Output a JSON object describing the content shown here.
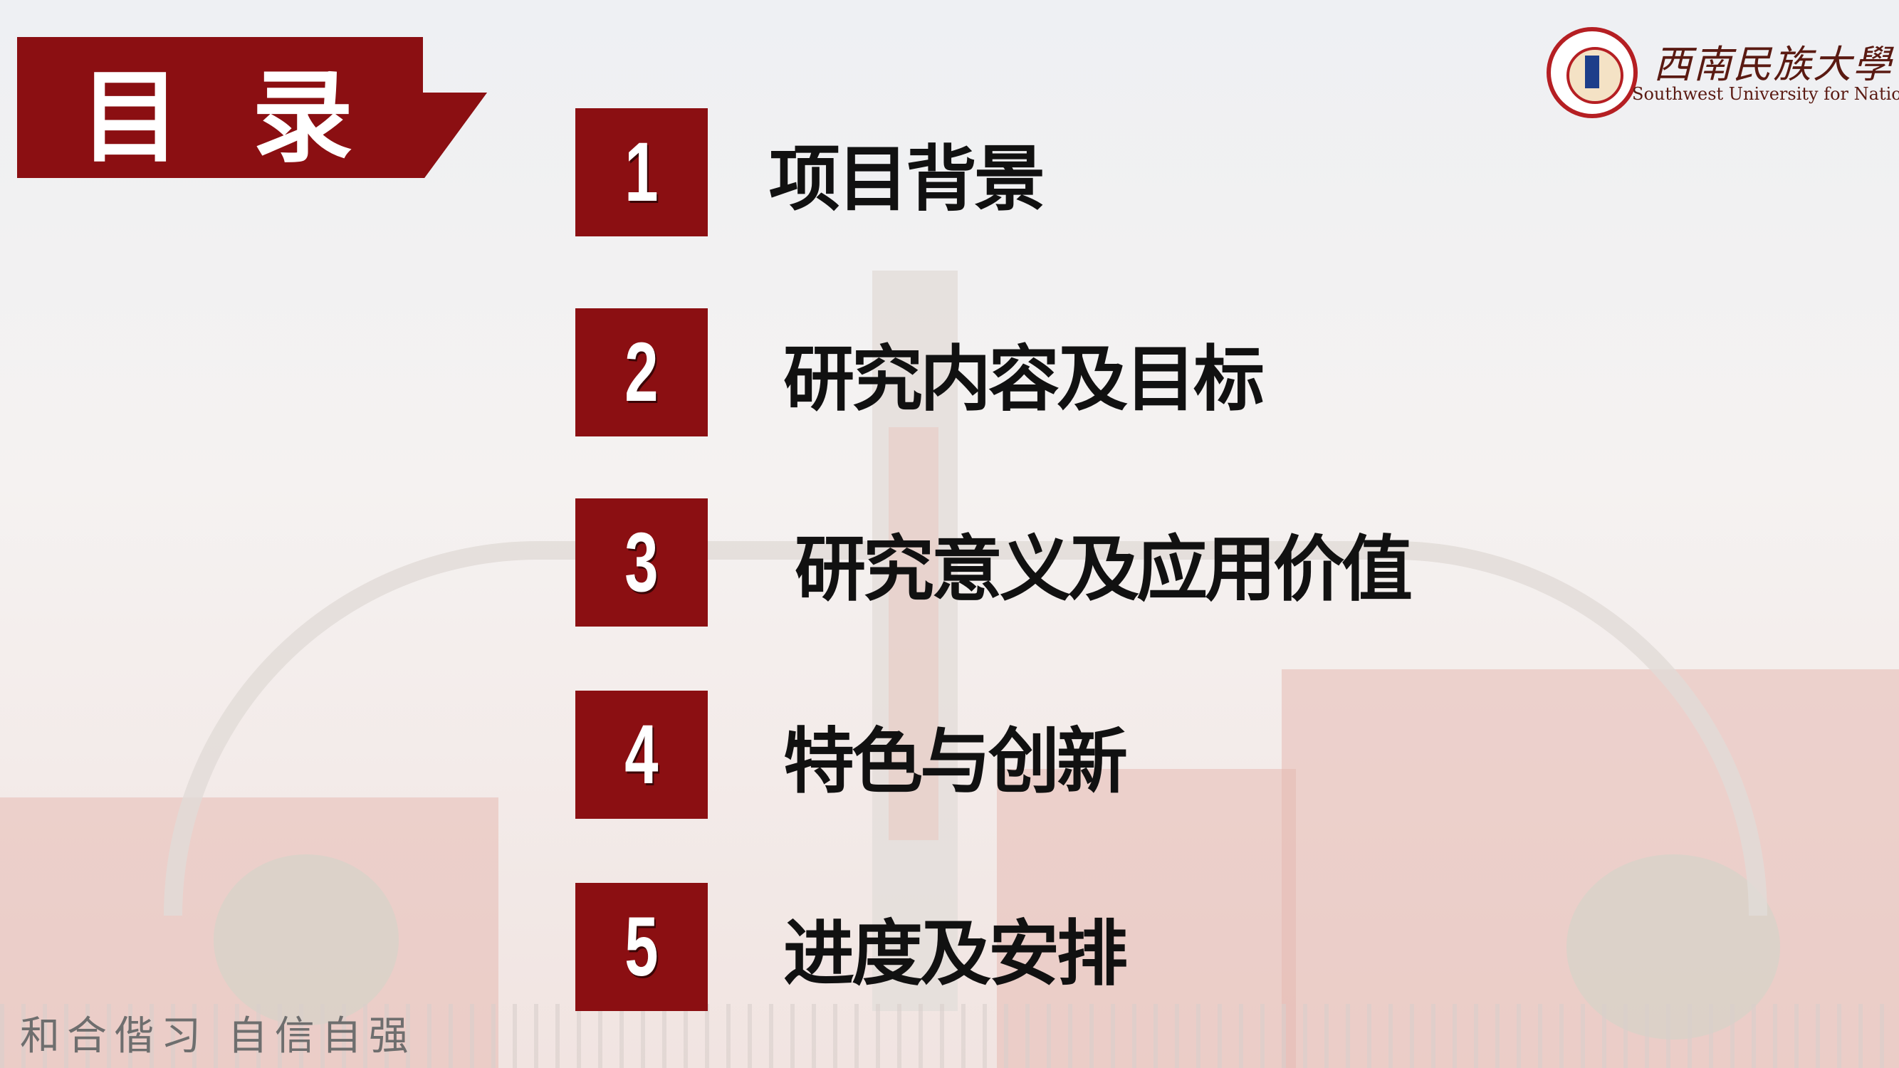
{
  "title": "目 录",
  "title_chars": [
    "目",
    "录"
  ],
  "logo": {
    "name": "西南民族大學",
    "subtitle": "Southwest University for Nationalities"
  },
  "agenda": [
    {
      "number": "1",
      "label": "项目背景"
    },
    {
      "number": "2",
      "label": "研究内容及目标"
    },
    {
      "number": "3",
      "label": "研究意义及应用价值"
    },
    {
      "number": "4",
      "label": "特色与创新"
    },
    {
      "number": "5",
      "label": "进度及安排"
    }
  ],
  "motto": "和合偕习  自信自强",
  "colors": {
    "accent": "#8b0f12",
    "text": "#111111"
  }
}
